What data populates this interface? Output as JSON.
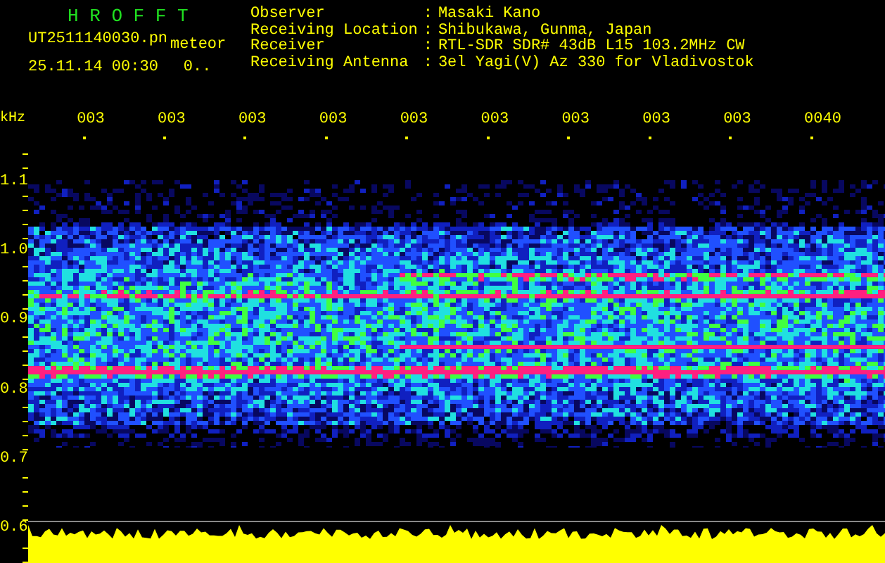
{
  "app_title": "H R O F F T",
  "file_name": "UT2511140030.pn",
  "mode": "meteor",
  "timestamp": "25.11.14 00:30",
  "count": "0..",
  "info": [
    {
      "label": "Observer",
      "separator": ":",
      "value": "Masaki Kano"
    },
    {
      "label": "Receiving Location",
      "separator": ":",
      "value": "Shibukawa, Gunma, Japan"
    },
    {
      "label": "Receiver",
      "separator": ":",
      "value": "RTL-SDR SDR# 43dB L15 103.2MHz CW"
    },
    {
      "label": "Receiving Antenna",
      "separator": ":",
      "value": "3el Yagi(V) Az 330 for Vladivostok"
    }
  ],
  "time_axis": [
    "003",
    "003",
    "003",
    "003",
    "003",
    "003",
    "003",
    "003",
    "003",
    "0040"
  ],
  "freq_axis": {
    "unit": "kHz",
    "labels": [
      "1.1",
      "1.0",
      "0.9",
      "0.8",
      "0.7",
      "0.6"
    ]
  }
}
